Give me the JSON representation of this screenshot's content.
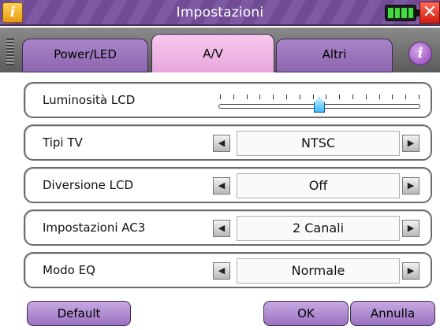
{
  "window": {
    "title": "Impostazioni"
  },
  "titlebar": {
    "info_glyph": "i",
    "close_glyph": "✕"
  },
  "tabs": [
    {
      "label": "Power/LED",
      "active": false
    },
    {
      "label": "A/V",
      "active": true
    },
    {
      "label": "Altri",
      "active": false
    }
  ],
  "help_glyph": "i",
  "settings": {
    "brightness": {
      "label": "Luminosità LCD",
      "level": 0.5,
      "ticks": 16
    },
    "tv_type": {
      "label": "Tipi TV",
      "value": "NTSC"
    },
    "lcd_diversion": {
      "label": "Diversione LCD",
      "value": "Off"
    },
    "ac3": {
      "label": "Impostazioni AC3",
      "value": "2 Canali"
    },
    "eq_mode": {
      "label": "Modo EQ",
      "value": "Normale"
    }
  },
  "arrows": {
    "left": "◀",
    "right": "▶"
  },
  "buttons": {
    "default": "Default",
    "ok": "OK",
    "cancel": "Annulla"
  },
  "colors": {
    "accent": "#7d5aa3",
    "active_tab": "#f0b6e6",
    "battery": "#3fdc3f",
    "slider_thumb": "#3cb8ff"
  },
  "icons": {
    "info": "info-icon",
    "battery": "battery-icon",
    "close": "close-icon",
    "help": "help-icon"
  }
}
